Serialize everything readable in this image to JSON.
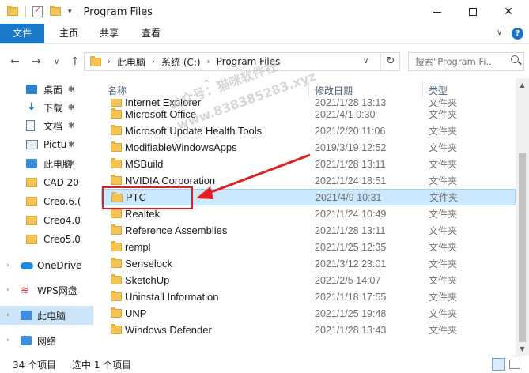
{
  "window": {
    "title": "Program Files",
    "minimize_glyph": "—",
    "maximize_glyph": "☐",
    "close_glyph": "✕"
  },
  "ribbon": {
    "tabs": [
      {
        "label": "文件",
        "active": true
      },
      {
        "label": "主页"
      },
      {
        "label": "共享"
      },
      {
        "label": "查看"
      }
    ],
    "collapse_glyph": "∨",
    "help_glyph": "?"
  },
  "nav": {
    "back_glyph": "←",
    "forward_glyph": "→",
    "recent_glyph": "∨",
    "up_glyph": "↑",
    "breadcrumb": [
      "此电脑",
      "系统 (C:)",
      "Program Files"
    ],
    "breadcrumb_sep": "›",
    "refresh_glyph": "↻",
    "search_placeholder": "搜索\"Program Fi..."
  },
  "sidebar": {
    "items": [
      {
        "label": "桌面",
        "icon": "desktop-icon",
        "pinned": true
      },
      {
        "label": "下载",
        "icon": "download-icon",
        "pinned": true
      },
      {
        "label": "文档",
        "icon": "documents-icon",
        "pinned": true
      },
      {
        "label": "Pictu",
        "icon": "pictures-icon",
        "pinned": true
      },
      {
        "label": "此电脑",
        "icon": "computer-icon",
        "pinned": true
      },
      {
        "label": "CAD 20",
        "icon": "folder-icon"
      },
      {
        "label": "Creo.6.(",
        "icon": "folder-icon"
      },
      {
        "label": "Creo4.0",
        "icon": "folder-icon"
      },
      {
        "label": "Creo5.0",
        "icon": "folder-icon"
      },
      {
        "label": "OneDrive",
        "icon": "onedrive-icon",
        "expandable": true
      },
      {
        "label": "WPS网盘",
        "icon": "wps-cloud-icon",
        "expandable": true
      },
      {
        "label": "此电脑",
        "icon": "computer-icon",
        "expandable": true,
        "selected": true
      },
      {
        "label": "网络",
        "icon": "network-icon",
        "expandable": true
      }
    ]
  },
  "columns": {
    "name": "名称",
    "date": "修改日期",
    "type": "类型"
  },
  "files": [
    {
      "name": "Internet Explorer",
      "date": "2021/1/28 13:13",
      "type": "文件夹",
      "clipped": true
    },
    {
      "name": "Microsoft Office",
      "date": "2021/4/1 0:30",
      "type": "文件夹"
    },
    {
      "name": "Microsoft Update Health Tools",
      "date": "2021/2/20 11:06",
      "type": "文件夹"
    },
    {
      "name": "ModifiableWindowsApps",
      "date": "2019/3/19 12:52",
      "type": "文件夹"
    },
    {
      "name": "MSBuild",
      "date": "2021/1/28 13:11",
      "type": "文件夹"
    },
    {
      "name": "NVIDIA Corporation",
      "date": "2021/1/24 18:51",
      "type": "文件夹"
    },
    {
      "name": "PTC",
      "date": "2021/4/9 10:31",
      "type": "文件夹",
      "selected": true
    },
    {
      "name": "Realtek",
      "date": "2021/1/24 10:49",
      "type": "文件夹"
    },
    {
      "name": "Reference Assemblies",
      "date": "2021/1/28 13:11",
      "type": "文件夹"
    },
    {
      "name": "rempl",
      "date": "2021/1/25 12:35",
      "type": "文件夹"
    },
    {
      "name": "Senselock",
      "date": "2021/3/12 23:01",
      "type": "文件夹"
    },
    {
      "name": "SketchUp",
      "date": "2021/2/5 14:07",
      "type": "文件夹"
    },
    {
      "name": "Uninstall Information",
      "date": "2021/1/18 17:55",
      "type": "文件夹"
    },
    {
      "name": "UNP",
      "date": "2021/1/25 19:48",
      "type": "文件夹"
    },
    {
      "name": "Windows Defender",
      "date": "2021/1/28 13:43",
      "type": "文件夹"
    }
  ],
  "watermark": {
    "line1": "公众号：猫咪软件社",
    "line2": "www.838385283.xyz"
  },
  "status": {
    "item_count": "34 个项目",
    "selection": "选中 1 个项目"
  },
  "colors": {
    "accent": "#1979ca",
    "selection_bg": "#cce8ff",
    "annotation_red": "#e02020"
  }
}
